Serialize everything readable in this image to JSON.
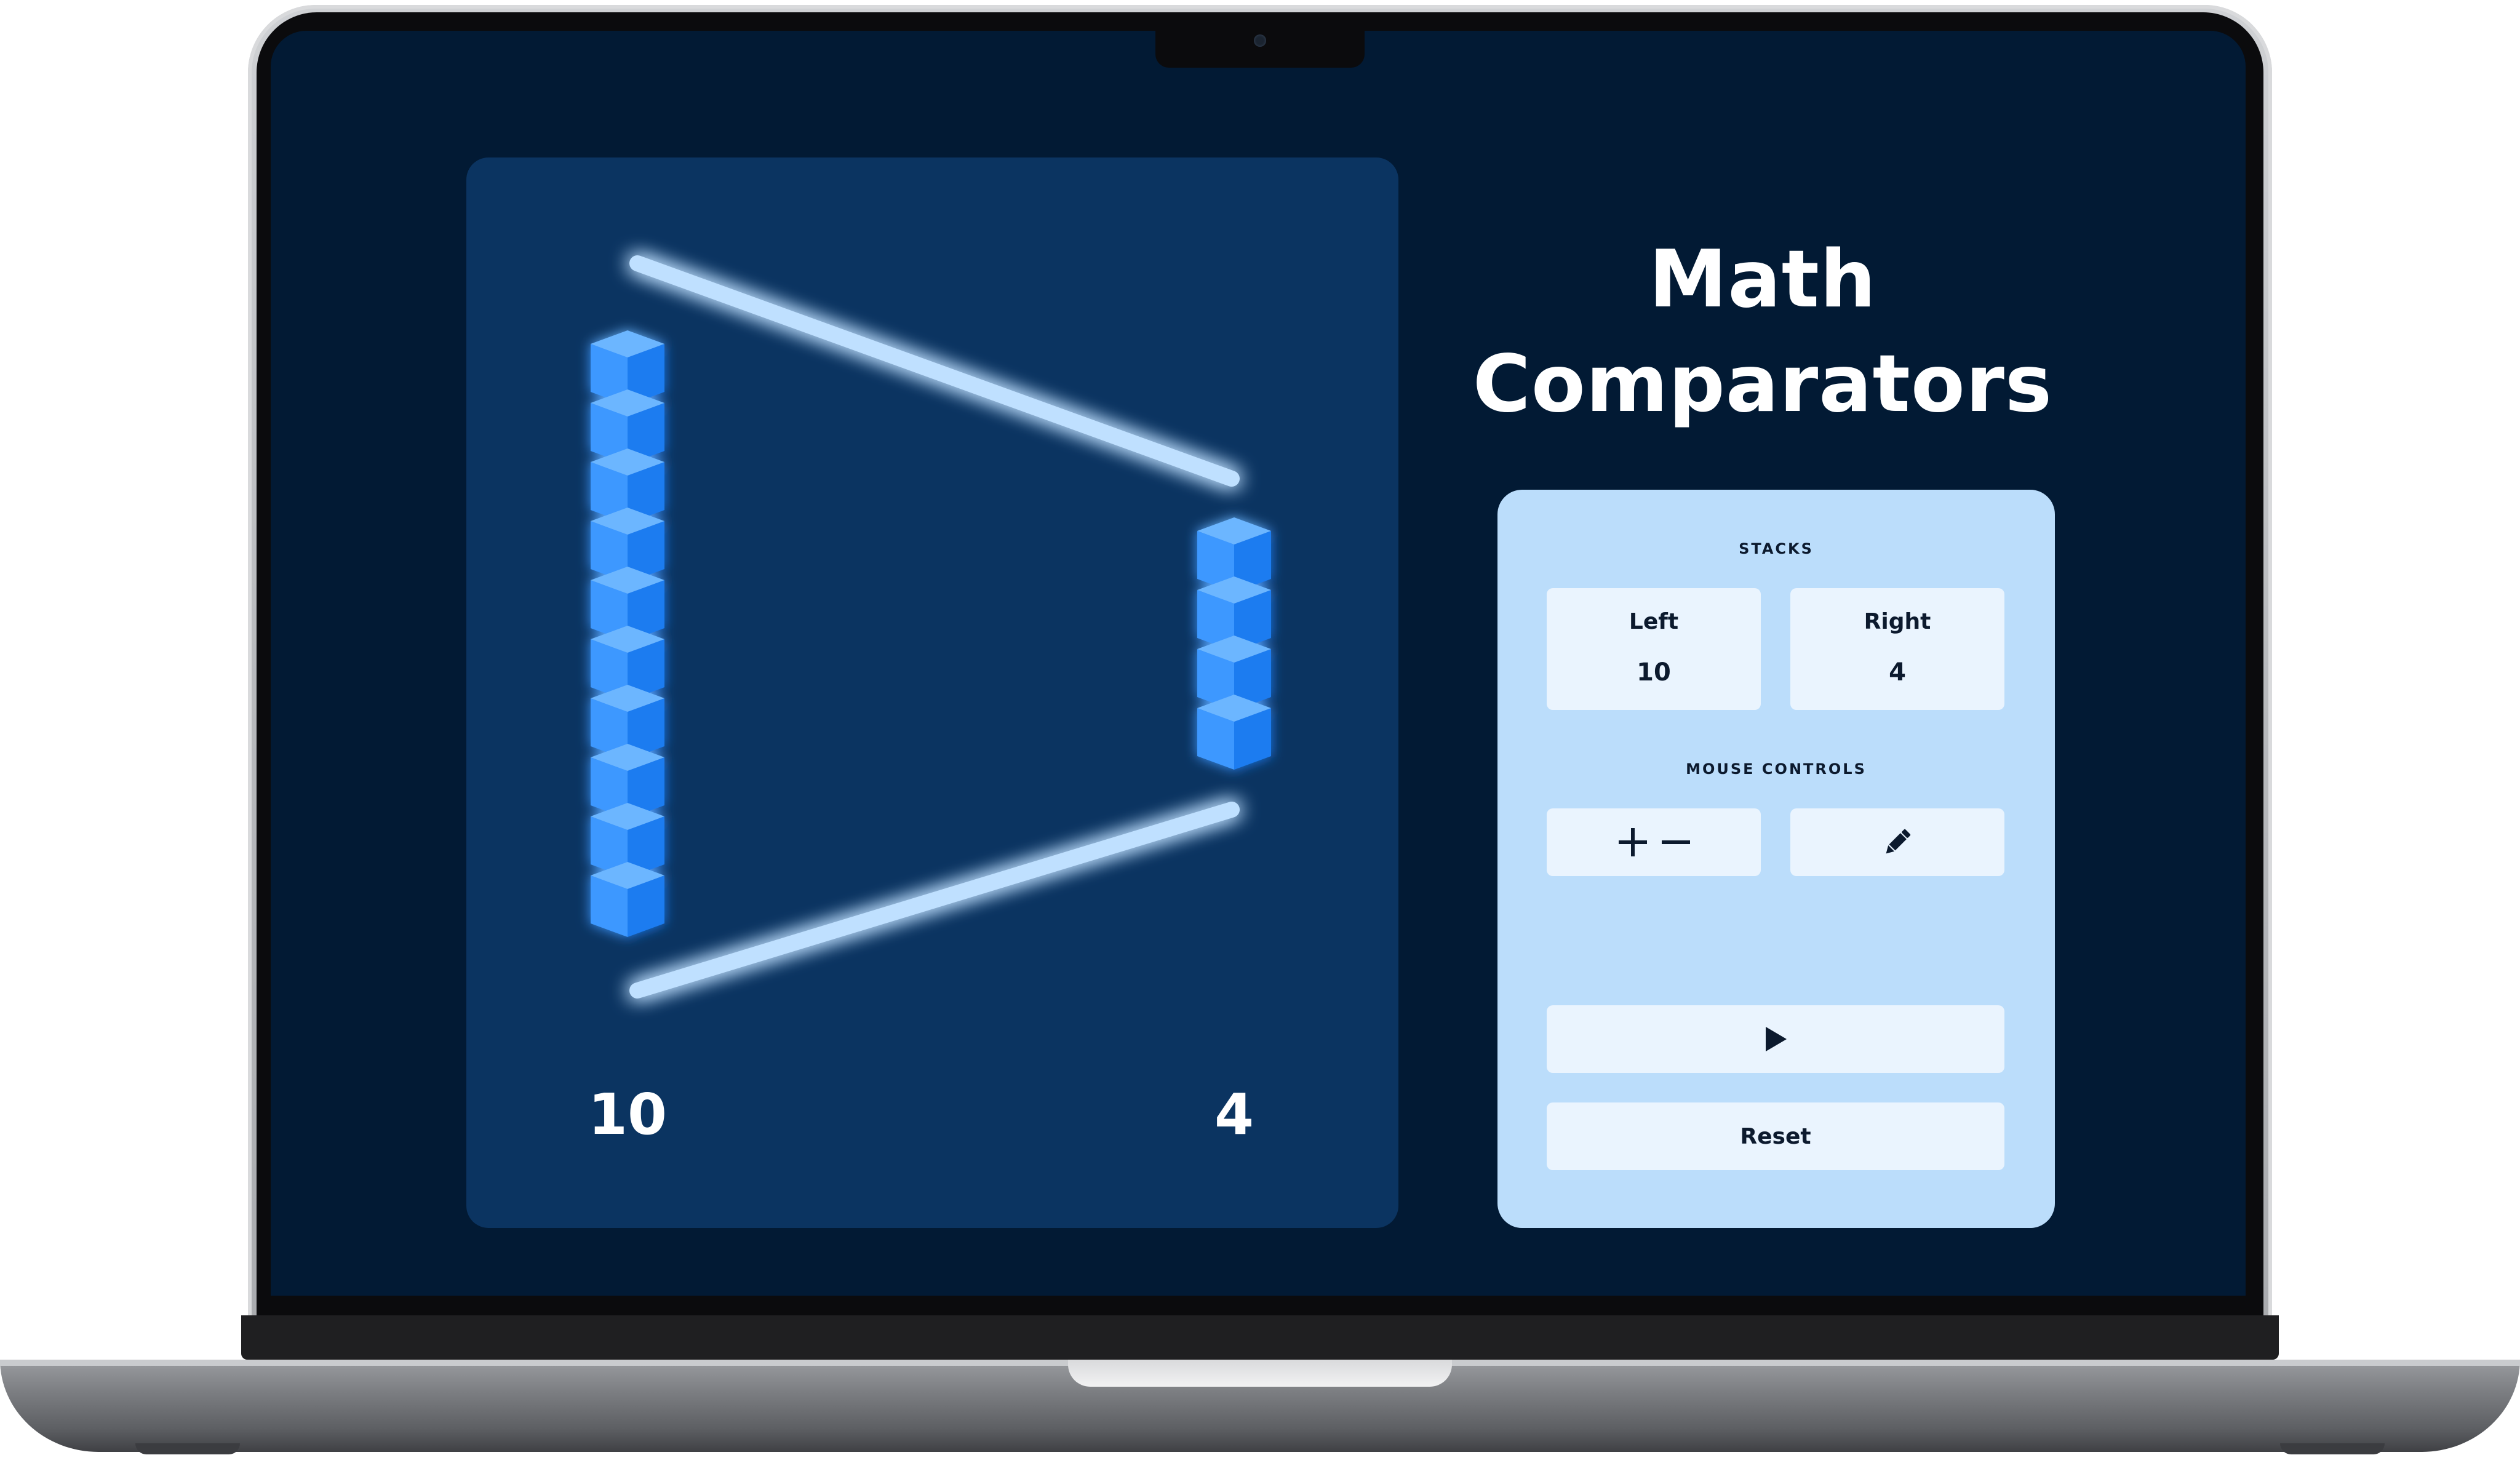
{
  "app": {
    "title_line1": "Math",
    "title_line2": "Comparators"
  },
  "visual": {
    "left_stack_count": 10,
    "right_stack_count": 4,
    "left_label": "10",
    "right_label": "4",
    "comparator_symbol": "greater-than",
    "cube_color": "#3d98ff",
    "line_color": "#bfe0ff"
  },
  "controls": {
    "stacks_heading": "STACKS",
    "left": {
      "label": "Left",
      "value": "10"
    },
    "right": {
      "label": "Right",
      "value": "4"
    },
    "mouse_heading": "MOUSE CONTROLS",
    "plus_minus_icon": "plus-minus-icon",
    "pencil_icon": "pencil-icon",
    "play_icon": "play-icon",
    "reset_label": "Reset"
  },
  "colors": {
    "screen_bg": "#021a34",
    "panel_bg": "#0b3461",
    "control_panel_bg": "#bbddfb",
    "button_bg": "#eaf4fe"
  }
}
